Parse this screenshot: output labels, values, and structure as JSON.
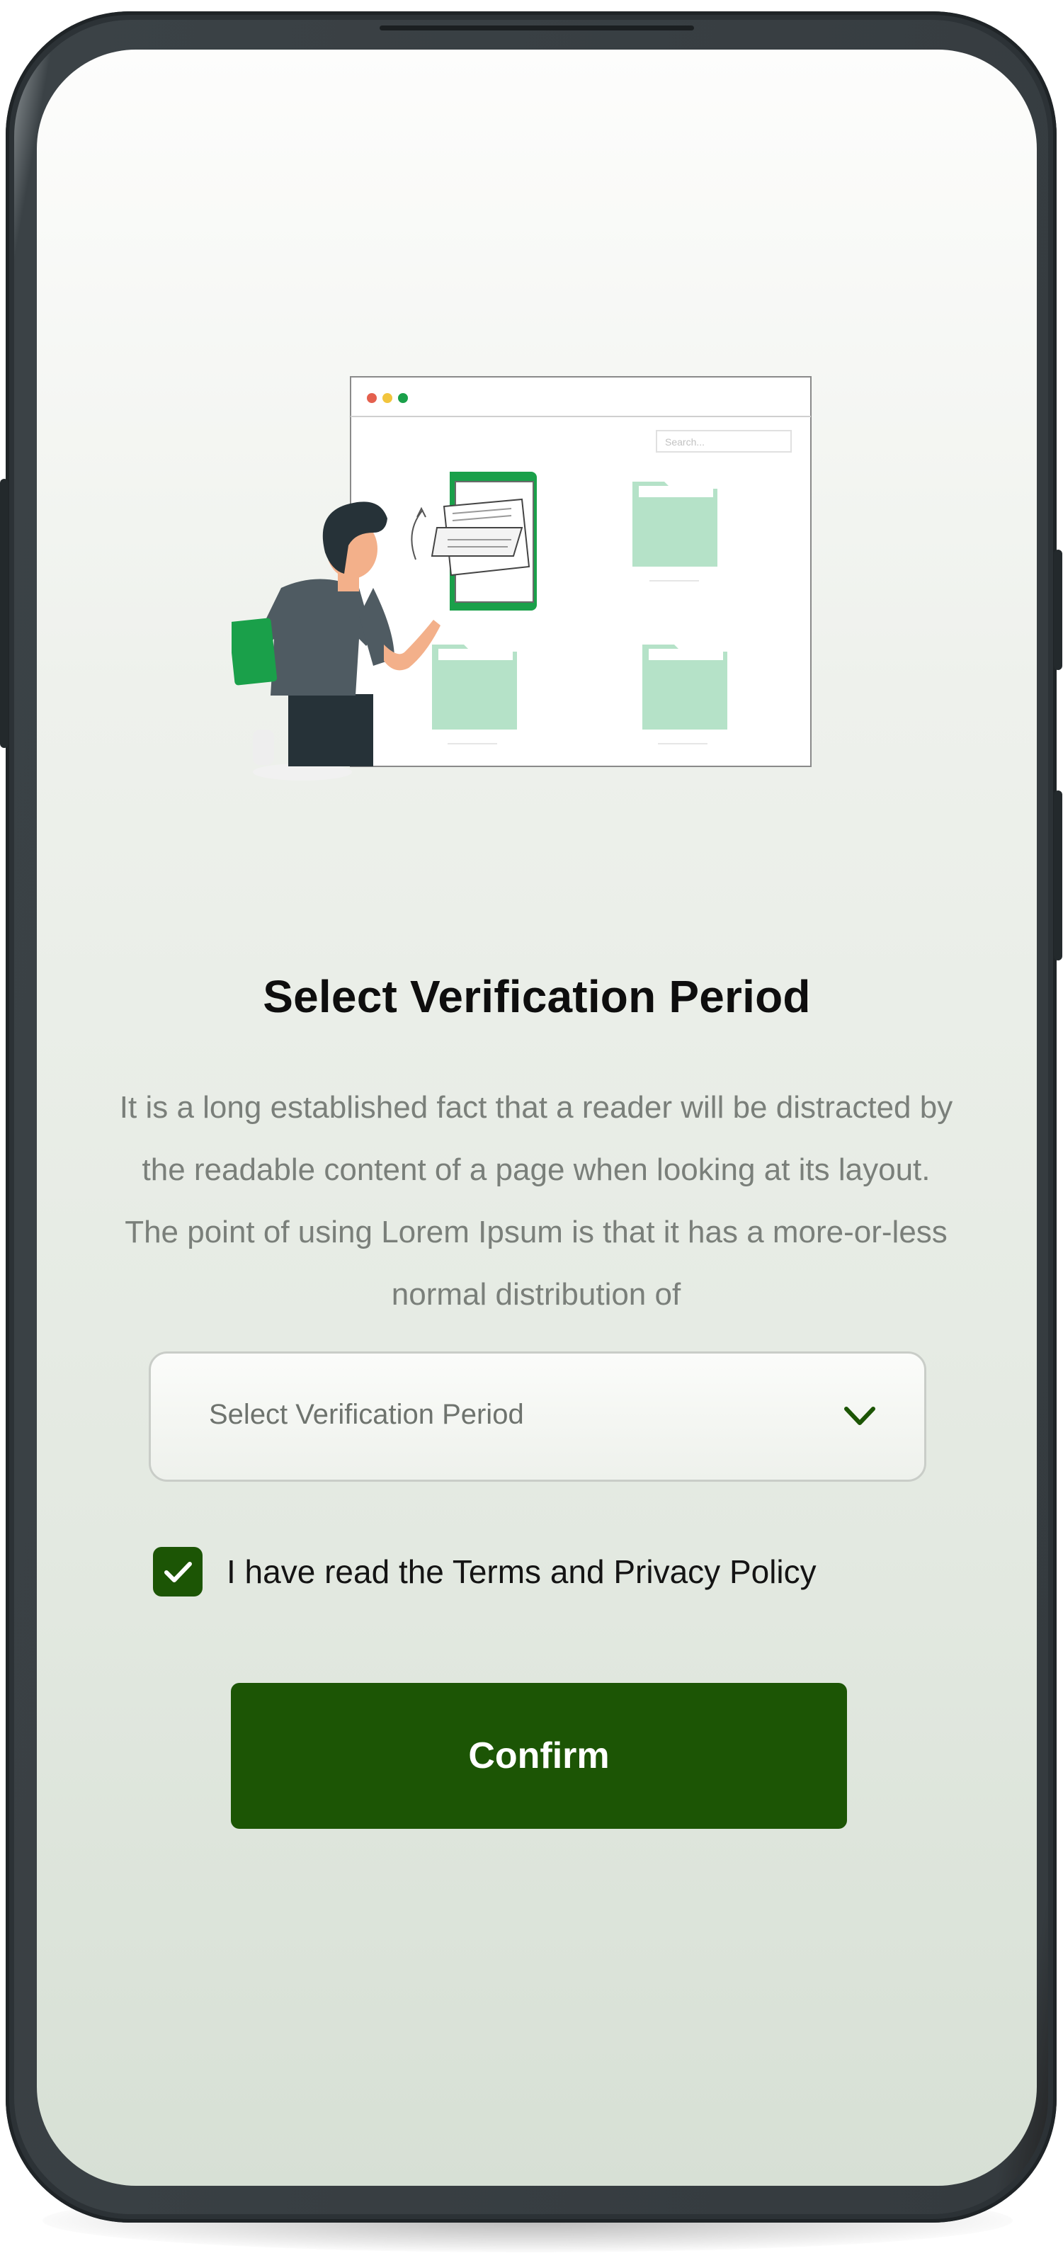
{
  "page": {
    "title": "Select Verification Period",
    "description": "It is a long established fact that a reader will be distracted by the readable content of a page when looking at its layout. The point of using Lorem Ipsum is that it has a more-or-less normal distribution of"
  },
  "illustration": {
    "search_placeholder": "Search..."
  },
  "select": {
    "placeholder": "Select Verification Period",
    "icon": "chevron-down-icon"
  },
  "terms": {
    "checked": true,
    "label": "I have read the Terms and Privacy Policy",
    "icon": "check-icon"
  },
  "confirm_label": "Confirm",
  "colors": {
    "primary": "#1c5505",
    "illustration_green": "#1aa04a",
    "folder_green": "#b5e2c8",
    "title": "#0e0e0e",
    "description": "#7a7f7a"
  }
}
